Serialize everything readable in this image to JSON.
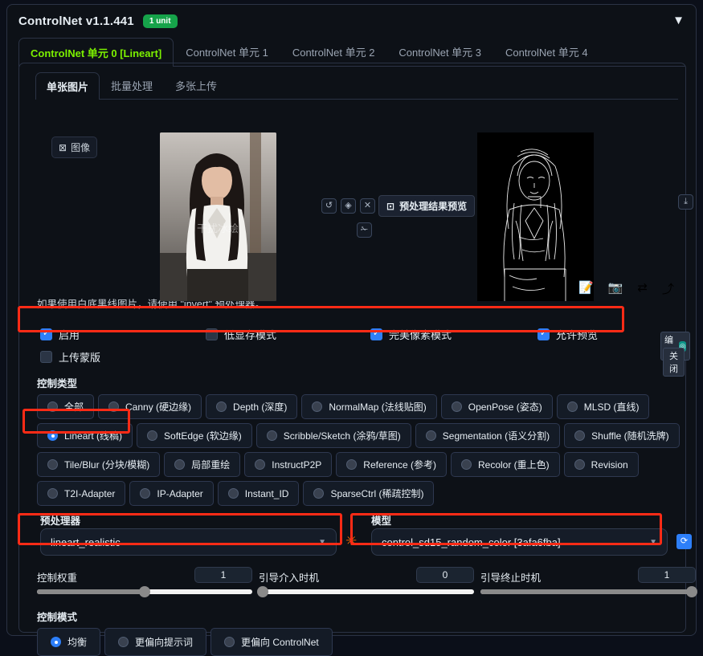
{
  "header": {
    "title": "ControlNet v1.1.441",
    "unit_badge": "1 unit",
    "collapse_icon": "▼",
    "badge_color": "#16a34a"
  },
  "unit_tabs": [
    {
      "label": "ControlNet 单元 0 [Lineart]",
      "active": true
    },
    {
      "label": "ControlNet 单元 1",
      "active": false
    },
    {
      "label": "ControlNet 单元 2",
      "active": false
    },
    {
      "label": "ControlNet 单元 3",
      "active": false
    },
    {
      "label": "ControlNet 单元 4",
      "active": false
    }
  ],
  "sub_tabs": [
    {
      "label": "单张图片",
      "active": true
    },
    {
      "label": "批量处理",
      "active": false
    },
    {
      "label": "多张上传",
      "active": false
    }
  ],
  "workarea": {
    "image_chip_label": "图像",
    "image_chip_icon": "⊠",
    "tool_undo": "↺",
    "tool_erase": "◈",
    "tool_close": "✕",
    "tool_wand": "✁",
    "preview_tag_label": "预处理结果预览",
    "preview_tag_icon": "⊡",
    "download_icon": "⤓",
    "edit_label": "编辑",
    "edit_icon": "◎",
    "close_label": "关闭",
    "source_watermark": "干扰冰绘"
  },
  "hint_text": "如果使用白底黑线图片，请使用 \"invert\" 预处理器。",
  "icon_strip": [
    {
      "name": "edit-prompt-icon",
      "glyph": "📝"
    },
    {
      "name": "camera-icon",
      "glyph": "📷"
    },
    {
      "name": "swap-icon",
      "glyph": "⇄"
    },
    {
      "name": "arrow-icon",
      "glyph": "⤴"
    }
  ],
  "checkboxes": {
    "enable": {
      "label": "启用",
      "checked": true
    },
    "low_vram": {
      "label": "低显存模式",
      "checked": false
    },
    "pixel_perfect": {
      "label": "完美像素模式",
      "checked": true
    },
    "allow_preview": {
      "label": "允许预览",
      "checked": true
    },
    "upload_mask": {
      "label": "上传蒙版",
      "checked": false
    }
  },
  "control_type": {
    "label": "控制类型",
    "selected": "Lineart (线稿)",
    "rows": [
      [
        "全部",
        "Canny (硬边缘)",
        "Depth (深度)",
        "NormalMap (法线贴图)",
        "OpenPose (姿态)",
        "MLSD (直线)"
      ],
      [
        "Lineart (线稿)",
        "SoftEdge (软边缘)",
        "Scribble/Sketch (涂鸦/草图)",
        "Segmentation (语义分割)",
        "Shuffle (随机洗牌)"
      ],
      [
        "Tile/Blur (分块/模糊)",
        "局部重绘",
        "InstructP2P",
        "Reference (参考)",
        "Recolor (重上色)",
        "Revision"
      ],
      [
        "T2I-Adapter",
        "IP-Adapter",
        "Instant_ID",
        "SparseCtrl (稀疏控制)"
      ]
    ]
  },
  "preprocessor": {
    "label": "预处理器",
    "value": "lineart_realistic",
    "caret": "▼",
    "run_icon": "✳"
  },
  "model": {
    "label": "模型",
    "value": "control_sd15_random_color [3afa6fba]",
    "caret": "▼",
    "refresh_icon": "⟳"
  },
  "sliders": [
    {
      "label": "控制权重",
      "value": "1",
      "pct": 50
    },
    {
      "label": "引导介入时机",
      "value": "0",
      "pct": 0
    },
    {
      "label": "引导终止时机",
      "value": "1",
      "pct": 100
    }
  ],
  "control_mode": {
    "label": "控制模式",
    "options": [
      {
        "label": "均衡",
        "selected": true
      },
      {
        "label": "更偏向提示词",
        "selected": false
      },
      {
        "label": "更偏向 ControlNet",
        "selected": false
      }
    ]
  },
  "colors": {
    "accent_green": "#7cf000",
    "accent_blue": "#2d7ff9",
    "highlight_red": "#ff2b16",
    "teal": "#0d9488"
  }
}
